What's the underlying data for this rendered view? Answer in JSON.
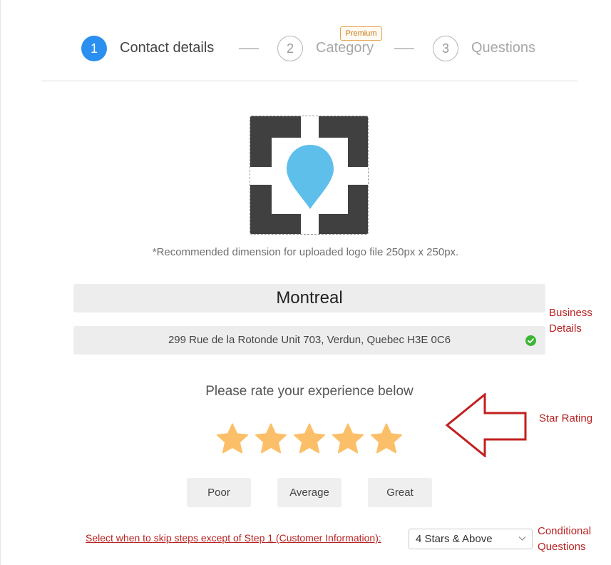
{
  "stepper": {
    "steps": [
      {
        "number": "1",
        "label": "Contact details",
        "state": "active"
      },
      {
        "number": "2",
        "label": "Category",
        "state": "inactive"
      },
      {
        "number": "3",
        "label": "Questions",
        "state": "inactive"
      }
    ],
    "premium_badge": "Premium"
  },
  "logo": {
    "icon": "map-pin-placeholder-icon",
    "note": "*Recommended dimension for uploaded logo file 250px x 250px."
  },
  "business": {
    "name": "Montreal",
    "address": "299 Rue de la Rotonde Unit 703, Verdun, Quebec H3E 0C6",
    "address_status_icon": "check-circle-icon"
  },
  "rating": {
    "prompt": "Please rate your experience below",
    "stars_filled": 5,
    "stars_total": 5,
    "buttons": [
      "Poor",
      "Average",
      "Great"
    ]
  },
  "skip": {
    "link_text": "Select when to skip steps except of Step 1 (Customer Information):",
    "selected": "4 Stars & Above"
  },
  "annotations": {
    "business_details_line1": "Business",
    "business_details_line2": "Details",
    "star_rating": "Star Rating",
    "conditional_line1": "Conditional",
    "conditional_line2": "Questions"
  },
  "colors": {
    "accent": "#2b8ff0",
    "star": "#fcbf69",
    "annotation": "#b82222",
    "success": "#3cb535",
    "pin": "#5ebfea"
  }
}
